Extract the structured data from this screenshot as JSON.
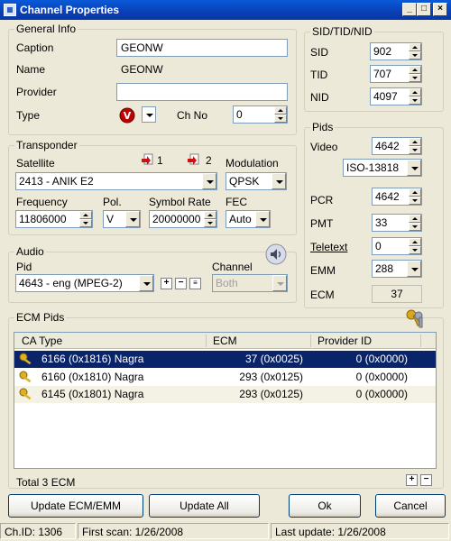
{
  "window": {
    "title": "Channel Properties"
  },
  "general": {
    "group_title": "General Info",
    "caption_label": "Caption",
    "caption_value": "GEONW",
    "name_label": "Name",
    "name_value": "GEONW",
    "provider_label": "Provider",
    "provider_value": "",
    "type_label": "Type",
    "type_icon": "video-type-icon",
    "chno_label": "Ch No",
    "chno_value": "0"
  },
  "sid": {
    "group_title": "SID/TID/NID",
    "sid_label": "SID",
    "sid_value": "902",
    "tid_label": "TID",
    "tid_value": "707",
    "nid_label": "NID",
    "nid_value": "4097"
  },
  "transponder": {
    "group_title": "Transponder",
    "satellite_label": "Satellite",
    "sat1_label": "1",
    "sat2_label": "2",
    "satellite_value": "2413 - ANIK E2",
    "modulation_label": "Modulation",
    "modulation_value": "QPSK",
    "frequency_label": "Frequency",
    "frequency_value": "11806000",
    "pol_label": "Pol.",
    "pol_value": "V",
    "symbol_label": "Symbol Rate",
    "symbol_value": "20000000",
    "fec_label": "FEC",
    "fec_value": "Auto"
  },
  "pids": {
    "group_title": "Pids",
    "video_label": "Video",
    "video_value": "4642",
    "video_type": "ISO-13818",
    "pcr_label": "PCR",
    "pcr_value": "4642",
    "pmt_label": "PMT",
    "pmt_value": "33",
    "teletext_label": "Teletext",
    "teletext_value": "0",
    "emm_label": "EMM",
    "emm_value": "288",
    "ecm_label": "ECM",
    "ecm_value": "37"
  },
  "audio": {
    "group_title": "Audio",
    "pid_label": "Pid",
    "pid_value": "4643  -  eng  (MPEG-2)",
    "channel_label": "Channel",
    "channel_value": "Both"
  },
  "ecm": {
    "group_title": "ECM Pids",
    "columns": [
      "CA Type",
      "ECM",
      "Provider ID"
    ],
    "rows": [
      {
        "ca_type": "6166  (0x1816) Nagra",
        "ecm": "37  (0x0025)",
        "provider": "0  (0x0000)"
      },
      {
        "ca_type": "6160  (0x1810) Nagra",
        "ecm": "293  (0x0125)",
        "provider": "0  (0x0000)"
      },
      {
        "ca_type": "6145  (0x1801) Nagra",
        "ecm": "293  (0x0125)",
        "provider": "0  (0x0000)"
      }
    ],
    "total": "Total 3 ECM"
  },
  "buttons": {
    "update_ecm": "Update ECM/EMM",
    "update_all": "Update All",
    "ok": "Ok",
    "cancel": "Cancel"
  },
  "status": {
    "chid": "Ch.ID: 1306",
    "first_scan": "First scan: 1/26/2008",
    "last_update": "Last update: 1/26/2008"
  }
}
